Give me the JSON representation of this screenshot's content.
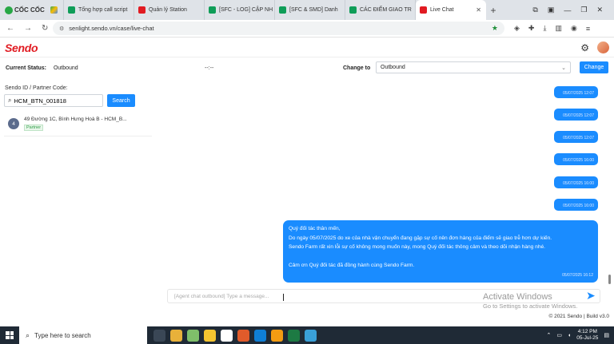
{
  "browser": {
    "brand": "CỐC CỐC",
    "tabs": [
      {
        "label": "",
        "color": "#4a7bd8"
      },
      {
        "label": "Tổng hợp call script",
        "color": "#0f9d58"
      },
      {
        "label": "Quản lý Station",
        "color": "#e11b22"
      },
      {
        "label": "[SFC - LOG] CẬP NH",
        "color": "#0f9d58"
      },
      {
        "label": "[SFC & SMD] Danh",
        "color": "#0f9d58"
      },
      {
        "label": "CÁC ĐIỂM GIAO TR",
        "color": "#0f9d58"
      },
      {
        "label": "Live Chat",
        "color": "#e11b22"
      }
    ],
    "url": "senlight.sendo.vn/case/live-chat"
  },
  "app": {
    "logo": "Sendo"
  },
  "status": {
    "current_label": "Current Status:",
    "current_value": "Outbound",
    "time_value": "--:--",
    "change_to_label": "Change to",
    "change_to_value": "Outbound",
    "change_button": "Change"
  },
  "search": {
    "label": "Sendo ID / Partner Code:",
    "value": "HCM_BTN_001818",
    "button": "Search"
  },
  "conversations": [
    {
      "badge": "4",
      "address": "49 Đường 1C, Bình Hưng Hoà B - HCM_B...",
      "tag": "Partner"
    }
  ],
  "messages": [
    {
      "time": "05/07/2025 12:07"
    },
    {
      "time": "05/07/2025 12:07"
    },
    {
      "time": "05/07/2025 12:07"
    },
    {
      "time": "05/07/2025 16:00"
    },
    {
      "time": "05/07/2025 16:00"
    },
    {
      "time": "05/07/2025 16:00"
    }
  ],
  "long_message": {
    "lines": [
      "Quý đối tác thân mến,",
      "Do ngày 05/07/2025 do xe của nhà vận chuyển đang gặp sự cố nên đơn hàng của điểm sẽ giao trễ hơn dự kiến.",
      "Sendo Farm rất xin lỗi sự cố không mong muốn này, mong  Quý đối tác thông cảm và theo dõi nhận hàng nhé.",
      "",
      "Cảm ơn Quý đối tác đã đồng hành cùng Sendo Farm."
    ],
    "time": "05/07/2025 16:12"
  },
  "composer": {
    "placeholder": "[Agent chat outbound] Type a message..."
  },
  "watermark": {
    "line1": "Activate Windows",
    "line2": "Go to Settings to activate Windows."
  },
  "footer": "© 2021 Sendo | Build v3.0",
  "taskbar": {
    "search_placeholder": "Type here to search",
    "time": "4:12 PM",
    "date": "05-Jul-25"
  },
  "colors": {
    "accent": "#1a8cff",
    "brand": "#e11b22"
  }
}
